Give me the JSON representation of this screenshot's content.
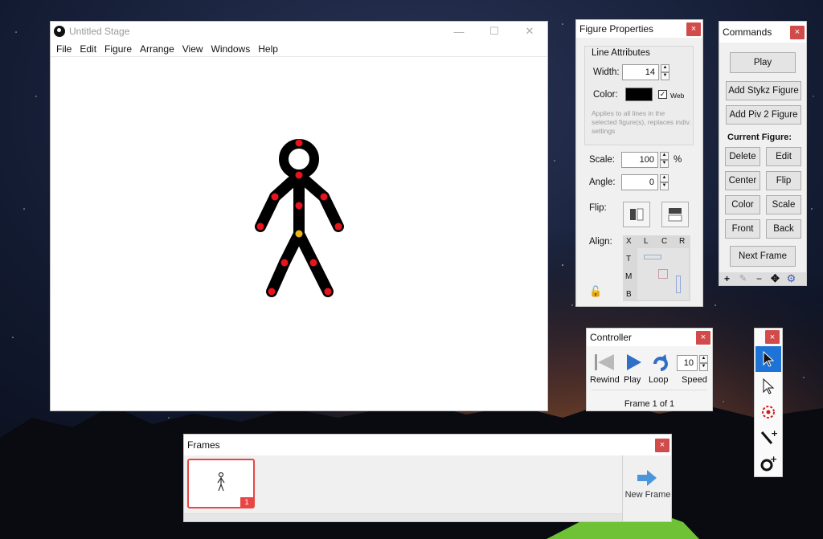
{
  "stage": {
    "title": "Untitled Stage",
    "win_min": "—",
    "win_max": "☐",
    "win_close": "✕",
    "menu": [
      "File",
      "Edit",
      "Figure",
      "Arrange",
      "View",
      "Windows",
      "Help"
    ]
  },
  "figure_properties": {
    "title": "Figure Properties",
    "close": "×",
    "line_attributes": "Line Attributes",
    "width_label": "Width:",
    "width_value": "14",
    "color_label": "Color:",
    "web_label": "Web",
    "note": "Applies to all lines in the selected figure(s), replaces indiv. settings",
    "scale_label": "Scale:",
    "scale_value": "100",
    "scale_unit": "%",
    "angle_label": "Angle:",
    "angle_value": "0",
    "flip_label": "Flip:",
    "align_label": "Align:",
    "align_cols": [
      "X",
      "L",
      "C",
      "R"
    ],
    "align_rows": [
      "T",
      "M",
      "B"
    ]
  },
  "commands": {
    "title": "Commands",
    "close": "×",
    "play": "Play",
    "add_stykz": "Add Stykz Figure",
    "add_piv2": "Add Piv 2 Figure",
    "current_figure": "Current Figure:",
    "delete": "Delete",
    "edit": "Edit",
    "center": "Center",
    "flip": "Flip",
    "color": "Color",
    "scale": "Scale",
    "front": "Front",
    "back": "Back",
    "next_frame": "Next Frame",
    "tool_add": "+",
    "tool_minus": "−"
  },
  "controller": {
    "title": "Controller",
    "close": "×",
    "rewind": "Rewind",
    "play": "Play",
    "loop": "Loop",
    "speed_label": "Speed",
    "speed_value": "10",
    "frame_status": "Frame 1 of 1"
  },
  "frames": {
    "title": "Frames",
    "close": "×",
    "frame_number": "1",
    "new_frame": "New Frame"
  },
  "toolbox": {
    "close": "×"
  },
  "colors": {
    "accent": "#1e74d6",
    "close_red": "#d24b4b",
    "joint_red": "#e8141c",
    "joint_origin": "#e8b418"
  }
}
